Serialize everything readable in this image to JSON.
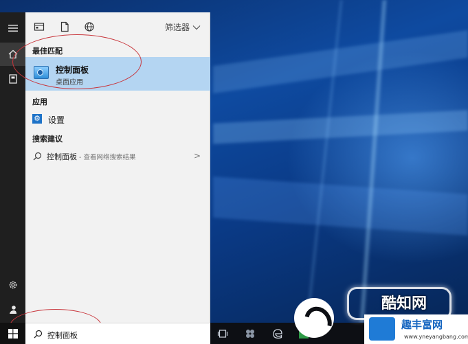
{
  "colors": {
    "selection": "#b4d5f2",
    "rail": "#1f1f1f",
    "panel": "#f2f2f2",
    "accent": "#1e73c8",
    "annotation": "#c8343a"
  },
  "rail": {
    "icons": [
      "menu-icon",
      "home-icon",
      "document-icon",
      "gear-icon",
      "user-icon",
      "windows-icon"
    ]
  },
  "toolbar": {
    "filter_label": "筛选器"
  },
  "sections": {
    "best_match": "最佳匹配",
    "apps": "应用",
    "suggestions": "搜索建议"
  },
  "best_match": {
    "title": "控制面板",
    "subtitle": "桌面应用"
  },
  "apps": [
    {
      "label": "设置"
    }
  ],
  "suggestions": [
    {
      "main": "控制面板",
      "sub": " - 查看网络搜索结果"
    }
  ],
  "search": {
    "value": "控制面板"
  },
  "watermark": {
    "line1": "酷知网",
    "line2": "趣丰富网",
    "url": "www.yneyangbang.com"
  }
}
